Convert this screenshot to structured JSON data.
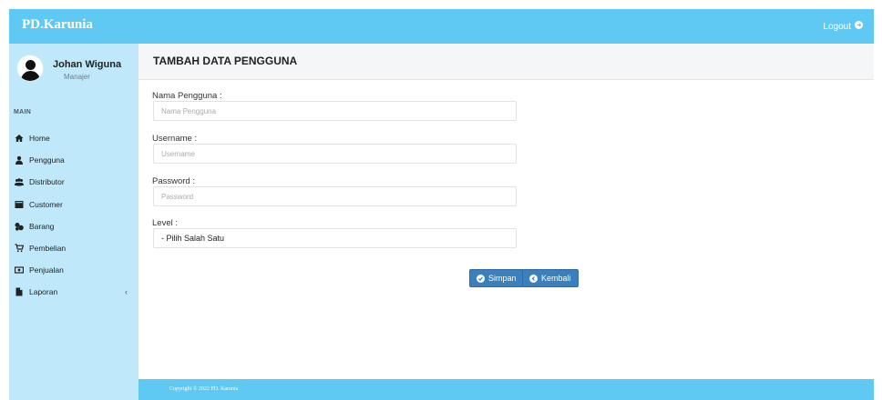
{
  "topbar": {
    "brand": "PD.Karunia",
    "logout_label": "Logout"
  },
  "user": {
    "name": "Johan Wiguna",
    "role": "Manajer"
  },
  "sidebar": {
    "section_label": "MAIN",
    "items": [
      {
        "label": "Home",
        "icon": "home-icon"
      },
      {
        "label": "Pengguna",
        "icon": "user-icon"
      },
      {
        "label": "Distributor",
        "icon": "users-icon"
      },
      {
        "label": "Customer",
        "icon": "id-card-icon"
      },
      {
        "label": "Barang",
        "icon": "boxes-icon"
      },
      {
        "label": "Pembelian",
        "icon": "cart-icon"
      },
      {
        "label": "Penjualan",
        "icon": "money-icon"
      },
      {
        "label": "Laporan",
        "icon": "file-icon",
        "chevron": "‹"
      }
    ]
  },
  "form": {
    "title": "TAMBAH DATA PENGGUNA",
    "fields": {
      "nama": {
        "label": "Nama Pengguna :",
        "placeholder": "Nama Pengguna",
        "value": ""
      },
      "username": {
        "label": "Username :",
        "placeholder": "Username",
        "value": ""
      },
      "password": {
        "label": "Password :",
        "placeholder": "Password",
        "value": ""
      },
      "level": {
        "label": "Level :",
        "selected": "- Pilih Salah Satu"
      }
    },
    "buttons": {
      "save_label": "Simpan",
      "back_label": "Kembali"
    }
  },
  "footer": {
    "copyright": "Copyright © 2022 PD. Karunia"
  },
  "colors": {
    "accent": "#5fc9f4",
    "sidebar_bg": "#bfe9fb",
    "button": "#3c7fbd"
  }
}
